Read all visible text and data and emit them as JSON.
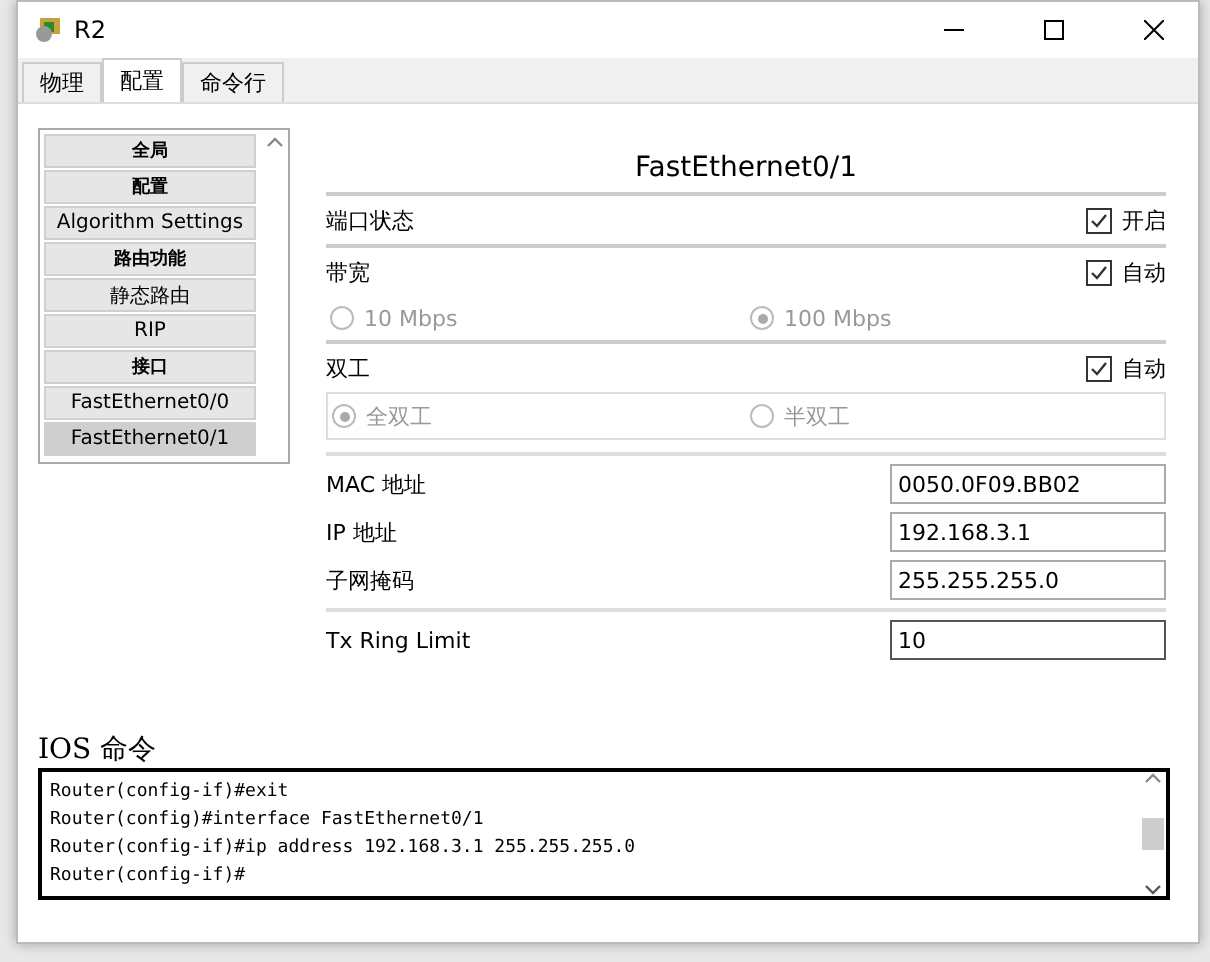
{
  "window": {
    "title": "R2"
  },
  "tabs": [
    {
      "label": "物理",
      "selected": false
    },
    {
      "label": "配置",
      "selected": true
    },
    {
      "label": "命令行",
      "selected": false
    }
  ],
  "sidebar": {
    "items": [
      {
        "label": "全局",
        "kind": "header",
        "selected": false
      },
      {
        "label": "配置",
        "kind": "header",
        "selected": false
      },
      {
        "label": "Algorithm Settings",
        "kind": "item",
        "selected": false
      },
      {
        "label": "路由功能",
        "kind": "header",
        "selected": false
      },
      {
        "label": "静态路由",
        "kind": "item",
        "selected": false
      },
      {
        "label": "RIP",
        "kind": "item",
        "selected": false
      },
      {
        "label": "接口",
        "kind": "header",
        "selected": false
      },
      {
        "label": "FastEthernet0/0",
        "kind": "item",
        "selected": false
      },
      {
        "label": "FastEthernet0/1",
        "kind": "item",
        "selected": true
      }
    ]
  },
  "panel": {
    "title": "FastEthernet0/1",
    "port_status": {
      "label": "端口状态",
      "checkbox": {
        "label": "开启",
        "checked": true
      }
    },
    "bandwidth": {
      "label": "带宽",
      "checkbox": {
        "label": "自动",
        "checked": true
      },
      "options": [
        {
          "label": "10 Mbps",
          "selected": false
        },
        {
          "label": "100 Mbps",
          "selected": true
        }
      ],
      "disabled": true
    },
    "duplex": {
      "label": "双工",
      "checkbox": {
        "label": "自动",
        "checked": true
      },
      "options": [
        {
          "label": "全双工",
          "selected": true
        },
        {
          "label": "半双工",
          "selected": false
        }
      ],
      "disabled": true
    },
    "fields": [
      {
        "label": "MAC 地址",
        "value": "0050.0F09.BB02",
        "focused": false
      },
      {
        "label": "IP 地址",
        "value": "192.168.3.1",
        "focused": false
      },
      {
        "label": "子网掩码",
        "value": "255.255.255.0",
        "focused": false
      }
    ],
    "tx_ring": {
      "label": "Tx Ring Limit",
      "value": "10",
      "focused": true
    }
  },
  "console": {
    "title": "IOS 命令",
    "lines": [
      "Router(config-if)#exit",
      "Router(config)#interface FastEthernet0/1",
      "Router(config-if)#ip address 192.168.3.1 255.255.255.0",
      "Router(config-if)#"
    ]
  }
}
